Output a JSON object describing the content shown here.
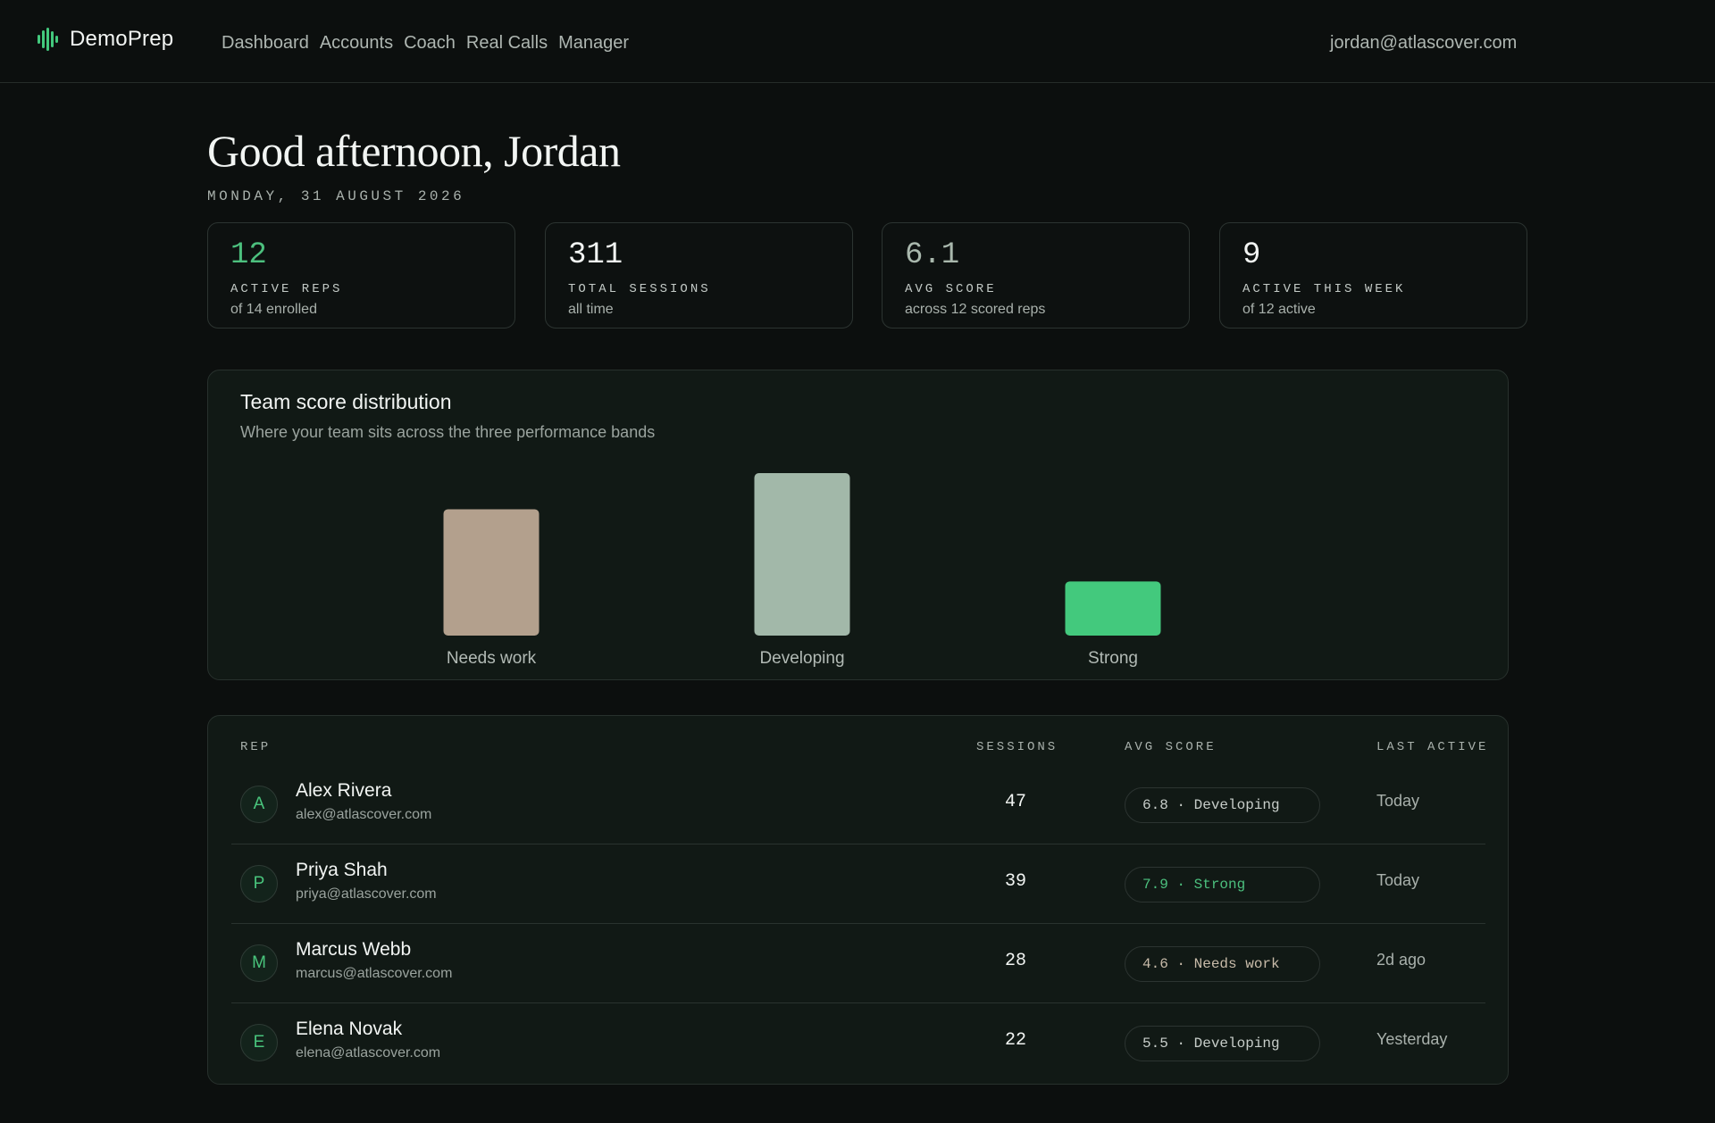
{
  "app": {
    "name": "DemoPrep",
    "accent": "#43c97d"
  },
  "nav": {
    "items": [
      "Dashboard",
      "Accounts",
      "Coach",
      "Real Calls",
      "Manager"
    ],
    "user_email": "jordan@atlascover.com"
  },
  "header": {
    "greeting": "Good afternoon, Jordan",
    "date": "MONDAY, 31 AUGUST 2026"
  },
  "stats": [
    {
      "value": "12",
      "label": "ACTIVE REPS",
      "sub": "of 14 enrolled",
      "color": "#4cc07e"
    },
    {
      "value": "311",
      "label": "TOTAL SESSIONS",
      "sub": "all time",
      "color": "#f2f5f3"
    },
    {
      "value": "6.1",
      "label": "AVG SCORE",
      "sub": "across 12 scored reps",
      "color": "#a9b8ad"
    },
    {
      "value": "9",
      "label": "ACTIVE THIS WEEK",
      "sub": "of 12 active",
      "color": "#f2f5f3"
    }
  ],
  "distribution": {
    "title": "Team score distribution",
    "subtitle": "Where your team sits across the three performance bands"
  },
  "chart_data": {
    "type": "bar",
    "categories": [
      "Needs work",
      "Developing",
      "Strong"
    ],
    "values": [
      3.5,
      4.5,
      1.5
    ],
    "colors": [
      "#b3a08d",
      "#a2b8a9",
      "#43c97d"
    ],
    "ylim": [
      0,
      4.5
    ],
    "grid": false,
    "legend": "none"
  },
  "table": {
    "headers": {
      "rep": "REP",
      "sessions": "SESSIONS",
      "avg_score": "AVG SCORE",
      "last_active": "LAST ACTIVE"
    },
    "rows": [
      {
        "initial": "A",
        "name": "Alex Rivera",
        "email": "alex@atlascover.com",
        "sessions": "47",
        "score": "6.8 · Developing",
        "band": "developing",
        "last_active": "Today"
      },
      {
        "initial": "P",
        "name": "Priya Shah",
        "email": "priya@atlascover.com",
        "sessions": "39",
        "score": "7.9 · Strong",
        "band": "strong",
        "last_active": "Today"
      },
      {
        "initial": "M",
        "name": "Marcus Webb",
        "email": "marcus@atlascover.com",
        "sessions": "28",
        "score": "4.6 · Needs work",
        "band": "needs",
        "last_active": "2d ago"
      },
      {
        "initial": "E",
        "name": "Elena Novak",
        "email": "elena@atlascover.com",
        "sessions": "22",
        "score": "5.5 · Developing",
        "band": "developing",
        "last_active": "Yesterday"
      }
    ]
  }
}
